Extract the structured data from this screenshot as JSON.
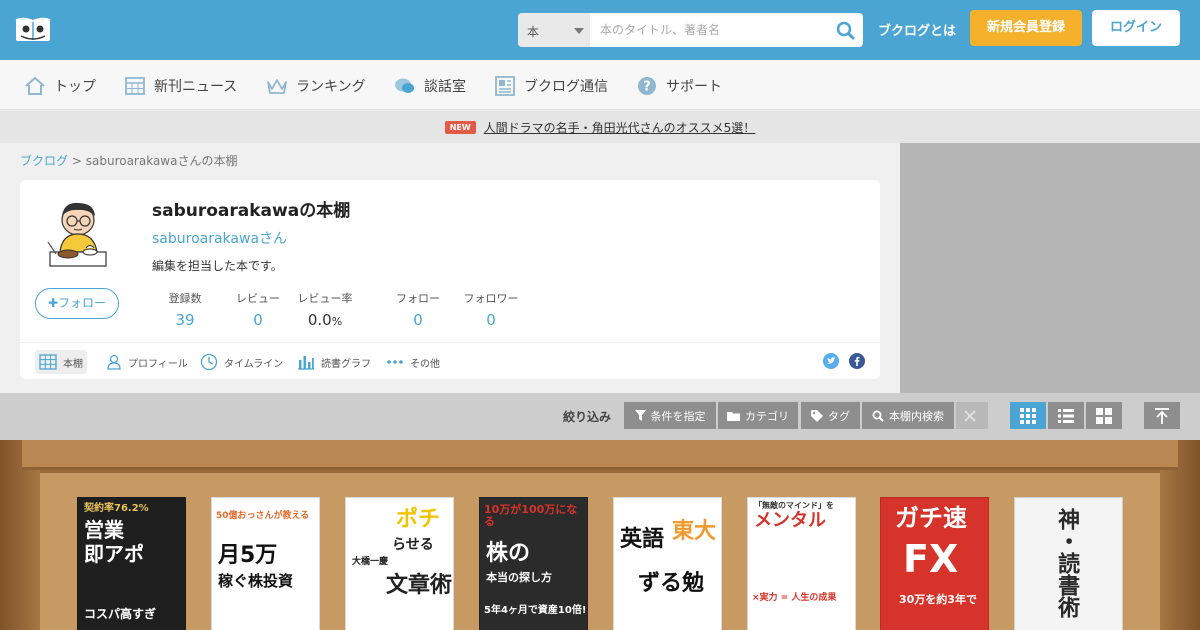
{
  "header": {
    "search_category": "本",
    "search_placeholder": "本のタイトル、著者名",
    "about_link": "ブクログとは",
    "signup": "新規会員登録",
    "login": "ログイン"
  },
  "nav": {
    "items": [
      {
        "label": "トップ",
        "icon": "home-icon"
      },
      {
        "label": "新刊ニュース",
        "icon": "calendar-icon"
      },
      {
        "label": "ランキング",
        "icon": "crown-icon"
      },
      {
        "label": "談話室",
        "icon": "chat-icon"
      },
      {
        "label": "ブクログ通信",
        "icon": "newspaper-icon"
      },
      {
        "label": "サポート",
        "icon": "help-icon"
      }
    ]
  },
  "notice": {
    "badge": "NEW",
    "text": "人間ドラマの名手・角田光代さんのオススメ5選！"
  },
  "breadcrumb": {
    "root": "ブクログ",
    "separator": ">",
    "current": "saburoarakawaさんの本棚"
  },
  "profile": {
    "shelf_title": "saburoarakawaの本棚",
    "user_link": "saburoarakawaさん",
    "bio": "編集を担当した本です。",
    "follow_button": "フォロー",
    "stats": [
      {
        "label": "登録数",
        "value": "39"
      },
      {
        "label": "レビュー",
        "value": "0"
      },
      {
        "label": "レビュー率",
        "value": "0.0",
        "unit": "%"
      },
      {
        "label": "フォロー",
        "value": "0"
      },
      {
        "label": "フォロワー",
        "value": "0"
      }
    ],
    "tabs": [
      {
        "label": "本棚",
        "icon": "grid-icon"
      },
      {
        "label": "プロフィール",
        "icon": "user-icon"
      },
      {
        "label": "タイムライン",
        "icon": "clock-icon"
      },
      {
        "label": "読書グラフ",
        "icon": "bar-graph-icon"
      },
      {
        "label": "その他",
        "icon": "more-icon"
      }
    ]
  },
  "filter": {
    "label": "絞り込み",
    "buttons": [
      {
        "label": "条件を指定",
        "icon": "funnel-icon"
      },
      {
        "label": "カテゴリ",
        "icon": "folder-icon"
      },
      {
        "label": "タグ",
        "icon": "tag-icon"
      },
      {
        "label": "本棚内検索",
        "icon": "search-icon"
      }
    ]
  },
  "books": [
    {
      "cover_lines": [
        "営業",
        "即アポ"
      ],
      "sub": "契約率76.2%",
      "bottom": "コスパ高すぎ",
      "colors": {
        "bg": "#1f1f1f",
        "fg": "#ffffff",
        "accent": "#e8c35a"
      }
    },
    {
      "cover_lines": [
        "月5万",
        "稼ぐ株投資"
      ],
      "sub": "50億おっさんが教える",
      "bottom": "",
      "colors": {
        "bg": "#ffffff",
        "fg": "#111111",
        "accent": "#e86a2a"
      }
    },
    {
      "cover_lines": [
        "ポチ",
        "らせる",
        "文章術"
      ],
      "sub": "大橋一慶",
      "bottom": "",
      "colors": {
        "bg": "#ffffff",
        "fg": "#222222",
        "accent": "#f2c400"
      }
    },
    {
      "cover_lines": [
        "株の",
        "本当の探し方"
      ],
      "sub": "10万が100万になる",
      "bottom": "5年4ヶ月で資産10倍!",
      "colors": {
        "bg": "#2b2b2b",
        "fg": "#ffffff",
        "accent": "#d6332a"
      }
    },
    {
      "cover_lines": [
        "東大",
        "英語",
        "ずる勉"
      ],
      "sub": "",
      "bottom": "",
      "colors": {
        "bg": "#ffffff",
        "fg": "#111111",
        "accent": "#f29a2e"
      }
    },
    {
      "cover_lines": [
        "メンタル"
      ],
      "sub": "「無敵のマインド」を",
      "bottom": "×実力 = 人生の成果",
      "colors": {
        "bg": "#ffffff",
        "fg": "#d6332a",
        "accent": "#d6332a"
      }
    },
    {
      "cover_lines": [
        "ガチ速",
        "FX"
      ],
      "sub": "",
      "bottom": "30万を約3年で",
      "colors": {
        "bg": "#d6332a",
        "fg": "#ffffff",
        "accent": "#ffffff"
      }
    },
    {
      "cover_lines": [
        "神・読書術"
      ],
      "sub": "",
      "bottom": "",
      "colors": {
        "bg": "#f4f4f4",
        "fg": "#111111",
        "accent": "#2a2a2a"
      }
    }
  ],
  "colors": {
    "primary": "#4aa5d2",
    "signup": "#f5b12b",
    "badge": "#e55a47",
    "shelf_wood": "#9b6a3b",
    "filter_bg": "#cdcdcd",
    "twitter": "#55acee",
    "facebook": "#3b5998"
  }
}
